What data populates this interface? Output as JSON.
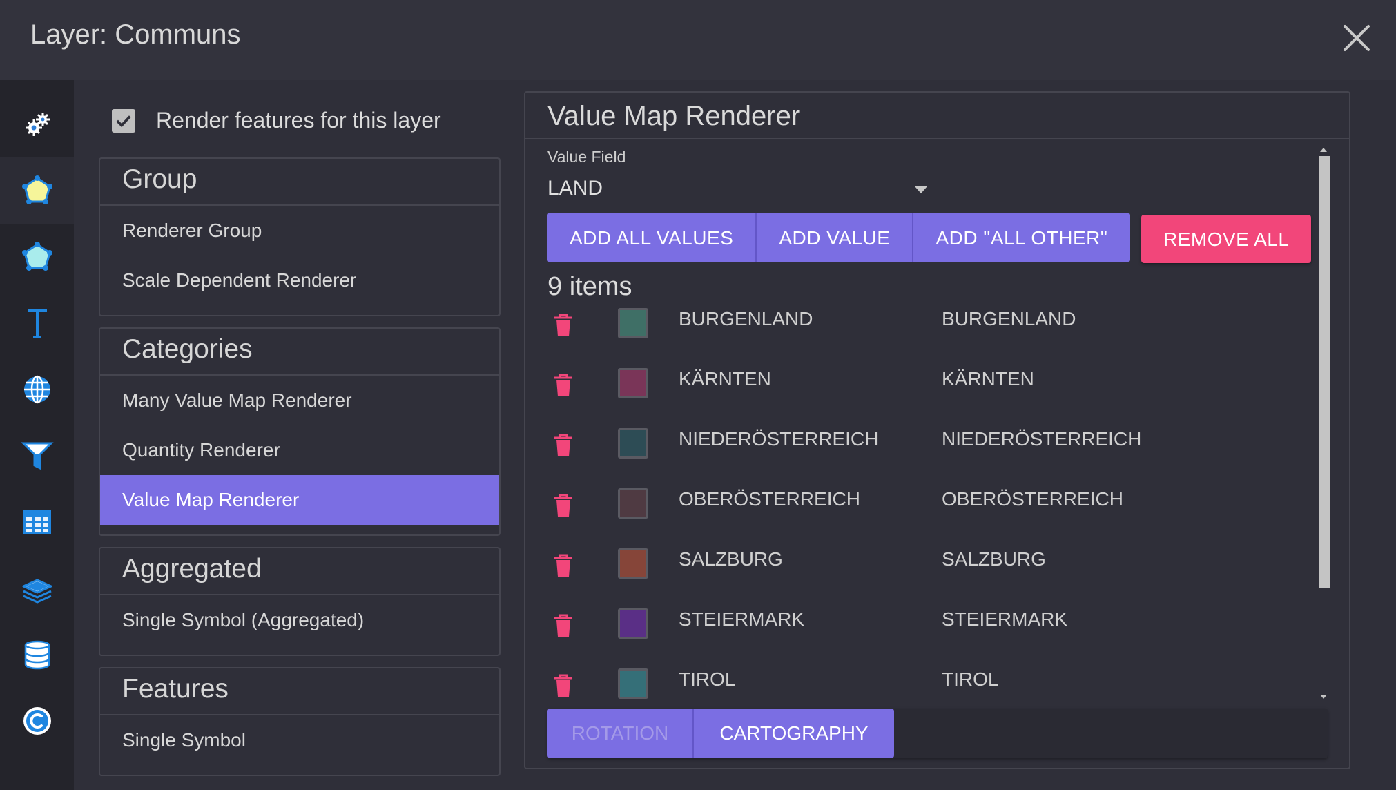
{
  "window": {
    "title": "Layer: Communs"
  },
  "sidebar_icons": [
    "gears-icon",
    "polygon-fill-icon",
    "polygon-outline-icon",
    "text-label-icon",
    "globe-icon",
    "filter-icon",
    "table-icon",
    "layers-icon",
    "database-icon",
    "copyright-icon"
  ],
  "render_features": {
    "label": "Render features for this layer",
    "checked": true
  },
  "groups": [
    {
      "heading": "Group",
      "items": [
        "Renderer Group",
        "Scale Dependent Renderer"
      ]
    },
    {
      "heading": "Categories",
      "items": [
        "Many Value Map Renderer",
        "Quantity Renderer",
        "Value Map Renderer"
      ],
      "selected": "Value Map Renderer"
    },
    {
      "heading": "Aggregated",
      "items": [
        "Single Symbol (Aggregated)"
      ]
    },
    {
      "heading": "Features",
      "items": [
        "Single Symbol"
      ]
    }
  ],
  "panel": {
    "title": "Value Map Renderer",
    "value_field_label": "Value Field",
    "value_field_value": "LAND",
    "buttons": {
      "add_all": "ADD ALL VALUES",
      "add_value": "ADD VALUE",
      "add_other": "ADD \"ALL OTHER\"",
      "remove_all": "REMOVE ALL"
    },
    "count_label": "9 items",
    "rows": [
      {
        "value": "BURGENLAND",
        "label": "BURGENLAND",
        "color": "#3f6f66"
      },
      {
        "value": "KÄRNTEN",
        "label": "KÄRNTEN",
        "color": "#7a3558"
      },
      {
        "value": "NIEDERÖSTERREICH",
        "label": "NIEDERÖSTERREICH",
        "color": "#2d4c55"
      },
      {
        "value": "OBERÖSTERREICH",
        "label": "OBERÖSTERREICH",
        "color": "#4f3a42"
      },
      {
        "value": "SALZBURG",
        "label": "SALZBURG",
        "color": "#864539"
      },
      {
        "value": "STEIERMARK",
        "label": "STEIERMARK",
        "color": "#5a2f86"
      },
      {
        "value": "TIROL",
        "label": "TIROL",
        "color": "#356f78"
      }
    ],
    "tabs": {
      "rotation": "ROTATION",
      "cartography": "CARTOGRAPHY"
    }
  },
  "colors": {
    "accent": "#7b6ee3",
    "danger": "#f2467a",
    "background": "#2f2f39",
    "icon_blue": "#1f86e0"
  }
}
